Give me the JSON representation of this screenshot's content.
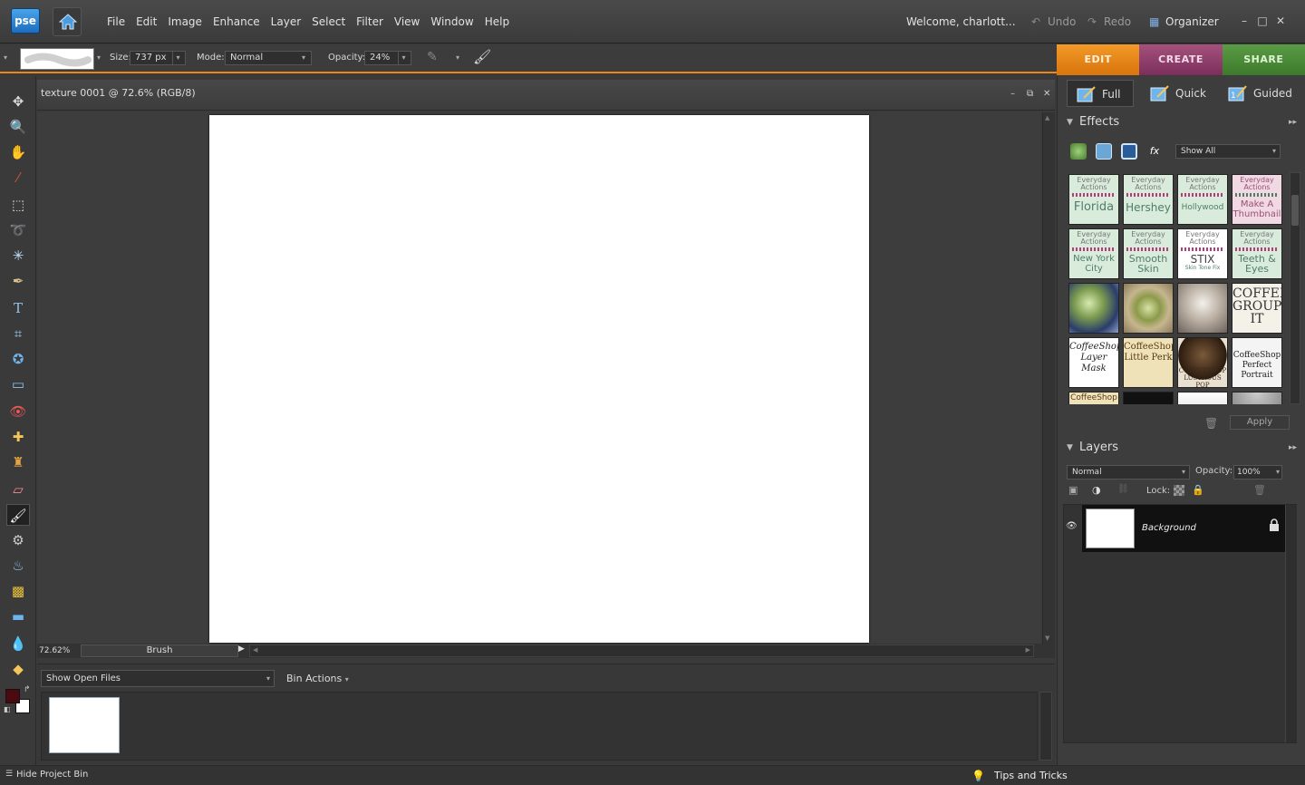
{
  "app": {
    "logo": "pse",
    "welcome": "Welcome, charlott..."
  },
  "menu": [
    "File",
    "Edit",
    "Image",
    "Enhance",
    "Layer",
    "Select",
    "Filter",
    "View",
    "Window",
    "Help"
  ],
  "title_actions": {
    "undo": "Undo",
    "redo": "Redo",
    "organizer": "Organizer"
  },
  "options": {
    "size_label": "Size:",
    "size_value": "737 px",
    "mode_label": "Mode:",
    "mode_value": "Normal",
    "opacity_label": "Opacity:",
    "opacity_value": "24%"
  },
  "mode_tabs": {
    "edit": "EDIT",
    "create": "CREATE",
    "share": "SHARE"
  },
  "sub_tabs": {
    "full": "Full",
    "quick": "Quick",
    "guided": "Guided"
  },
  "document": {
    "title": "texture 0001 @ 72.6% (RGB/8)",
    "zoom": "72.62%",
    "tool_status": "Brush"
  },
  "project_bin": {
    "show": "Show Open Files",
    "actions": "Bin Actions",
    "hide": "Hide Project Bin"
  },
  "tips": "Tips and Tricks",
  "effects": {
    "title": "Effects",
    "filter": "Show All",
    "apply": "Apply",
    "small_label": "Everyday Actions",
    "items": [
      {
        "small": "Everyday Actions",
        "big": "Florida"
      },
      {
        "small": "Everyday Actions",
        "big": "Hershey"
      },
      {
        "small": "Everyday Actions",
        "big": "Hollywood"
      },
      {
        "small": "Everyday Actions",
        "big": "Make A Thumbnail"
      },
      {
        "small": "Everyday Actions",
        "big": "New York City"
      },
      {
        "small": "Everyday Actions",
        "big": "Smooth Skin"
      },
      {
        "small": "Everyday Actions",
        "big": "STIX"
      },
      {
        "small": "Everyday Actions",
        "big": "Teeth & Eyes"
      }
    ],
    "stix_sub": "Skin Tone Fix",
    "group_it": "COFFEESHOP GROUP IT",
    "layer_mask": "CoffeeShop Layer Mask",
    "little_perk": "CoffeeShop Little Perk",
    "lustrous_pop": "COFFEESHOP LUSTROUS POP",
    "perfect_portrait": "CoffeeShop Perfect Portrait",
    "coffeeshop": "CoffeeShop"
  },
  "layers": {
    "title": "Layers",
    "blend": "Normal",
    "opacity_label": "Opacity:",
    "opacity": "100%",
    "lock_label": "Lock:",
    "layer_name": "Background"
  }
}
